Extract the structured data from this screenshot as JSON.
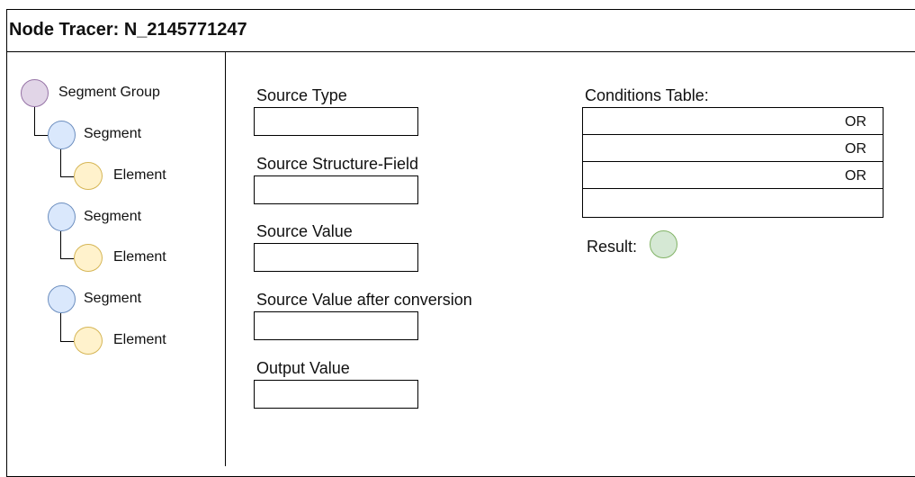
{
  "window": {
    "title": "Node Tracer: N_2145771247"
  },
  "tree": {
    "group_label": "Segment Group",
    "segments": [
      {
        "label": "Segment",
        "element_label": "Element"
      },
      {
        "label": "Segment",
        "element_label": "Element"
      },
      {
        "label": "Segment",
        "element_label": "Element"
      }
    ]
  },
  "fields": {
    "source_type_label": "Source Type",
    "source_structure_field_label": "Source Structure-Field",
    "source_value_label": "Source Value",
    "source_value_after_conversion_label": "Source Value after conversion",
    "output_value_label": "Output Value"
  },
  "conditions": {
    "label": "Conditions Table:",
    "rows": [
      {
        "operator": "OR"
      },
      {
        "operator": "OR"
      },
      {
        "operator": "OR"
      },
      {
        "operator": ""
      }
    ]
  },
  "result": {
    "label": "Result:"
  },
  "colors": {
    "group_fill": "#e1d5e7",
    "segment_fill": "#dae8fc",
    "element_fill": "#fff2cc",
    "result_fill": "#d5e8d4"
  }
}
